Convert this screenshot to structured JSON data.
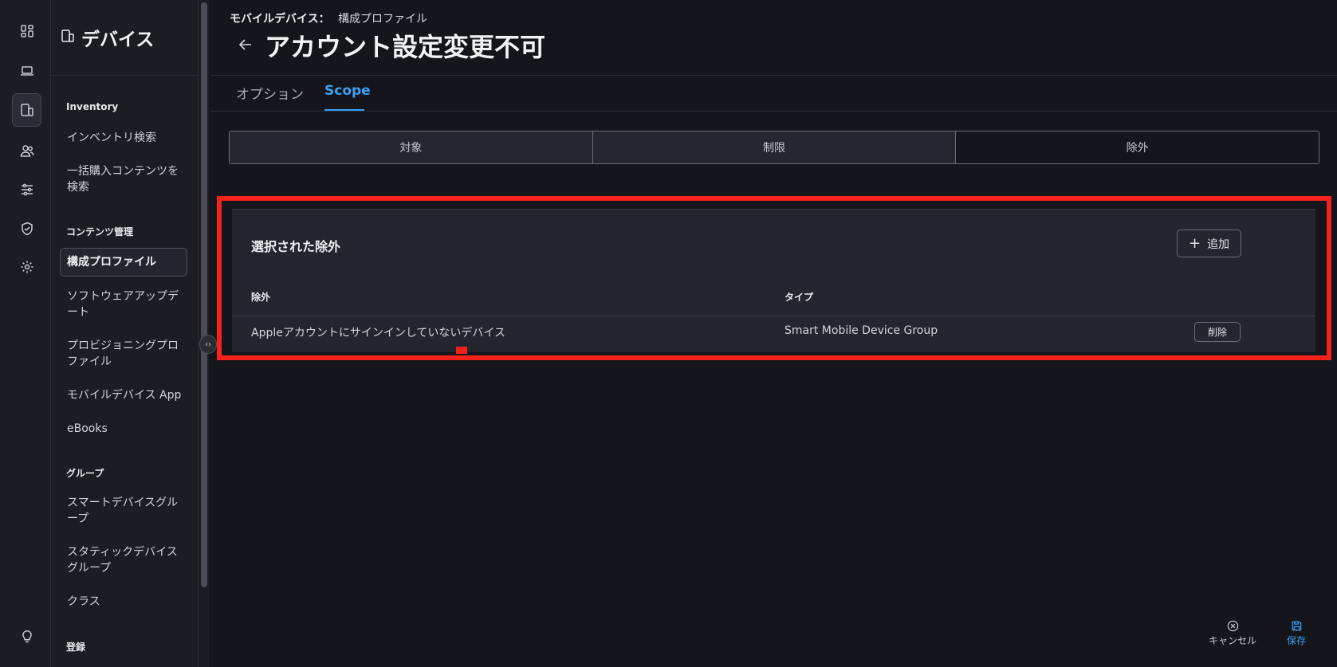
{
  "rail": {
    "items": [
      {
        "icon": "dashboard-icon"
      },
      {
        "icon": "laptop-icon"
      },
      {
        "icon": "mobile-devices-icon",
        "active": true
      },
      {
        "icon": "users-icon"
      },
      {
        "icon": "sliders-icon"
      },
      {
        "icon": "shield-check-icon"
      },
      {
        "icon": "gear-icon"
      },
      {
        "icon": "lightbulb-icon"
      }
    ]
  },
  "sidebar": {
    "title": "デバイス",
    "sections": {
      "inventory": "Inventory",
      "content": "コンテンツ管理",
      "groups": "グループ",
      "enroll": "登録"
    },
    "items": {
      "inventory_search": "インベントリ検索",
      "vpp_search": "一括購入コンテンツを検索",
      "config_profiles": "構成プロファイル",
      "software_update": "ソフトウェアアップデート",
      "provisioning": "プロビジョニングプロファイル",
      "mobile_apps": "モバイルデバイス App",
      "ebooks": "eBooks",
      "smart_groups": "スマートデバイスグループ",
      "static_groups": "スタティックデバイスグループ",
      "classes": "クラス"
    }
  },
  "header": {
    "breadcrumb_parent": "モバイルデバイス：",
    "breadcrumb_current": "構成プロファイル",
    "title": "アカウント設定変更不可"
  },
  "tabs": [
    {
      "label": "オプション",
      "active": false
    },
    {
      "label": "Scope",
      "active": true
    }
  ],
  "scope_segments": [
    {
      "label": "対象",
      "active": false
    },
    {
      "label": "制限",
      "active": false
    },
    {
      "label": "除外",
      "active": true
    }
  ],
  "exclusions_card": {
    "title": "選択された除外",
    "add_label": "追加",
    "columns": [
      "除外",
      "タイプ"
    ],
    "rows": [
      {
        "name": "Appleアカウントにサインインしていないデバイス",
        "type": "Smart Mobile Device Group",
        "action": "削除"
      }
    ]
  },
  "footer": {
    "cancel_label": "キャンセル",
    "save_label": "保存"
  },
  "colors": {
    "accent": "#3ba0f7",
    "highlight": "#f5211b"
  }
}
